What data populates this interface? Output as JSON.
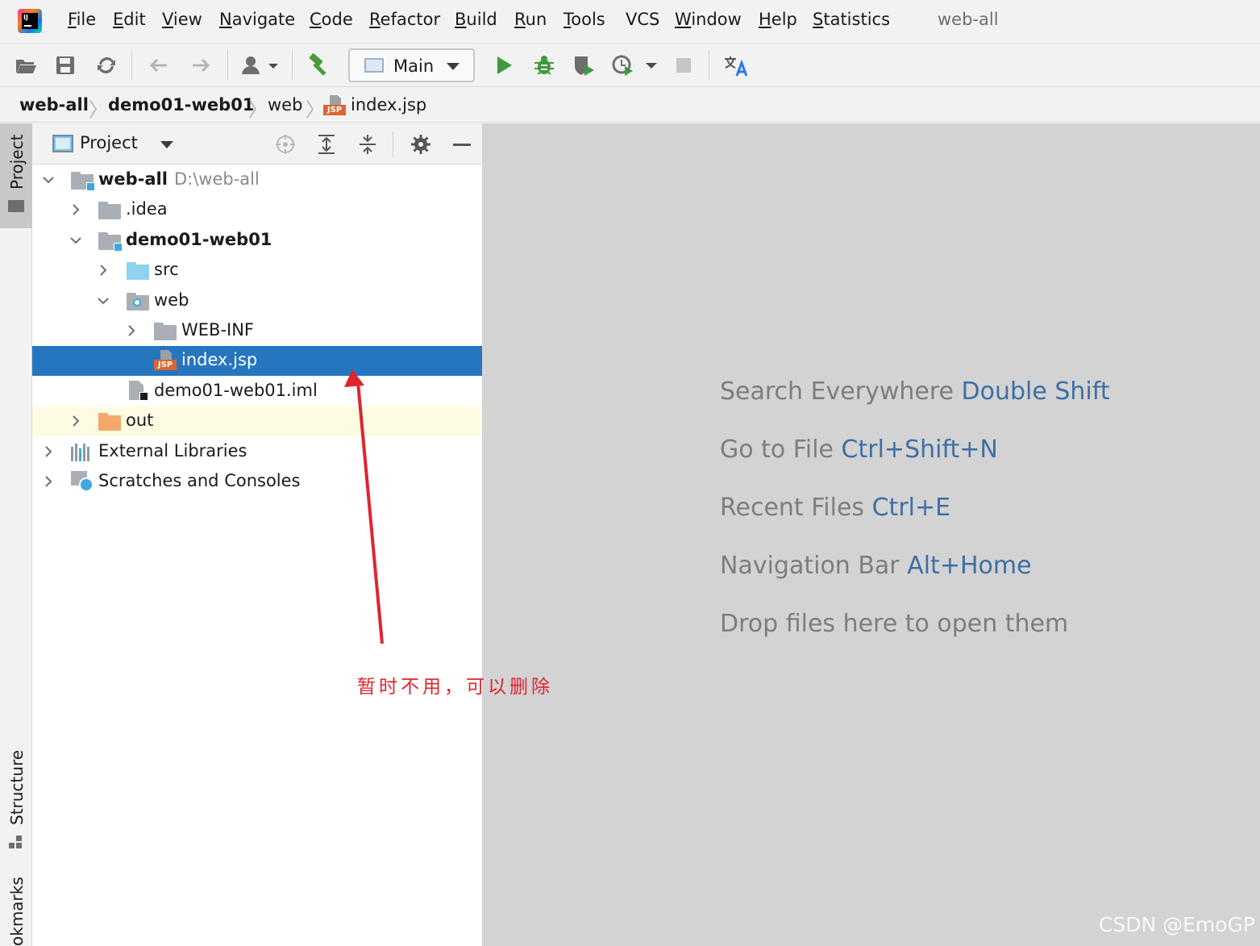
{
  "menubar": {
    "items": [
      {
        "mnemonic": "F",
        "rest": "ile"
      },
      {
        "mnemonic": "E",
        "rest": "dit"
      },
      {
        "mnemonic": "V",
        "rest": "iew"
      },
      {
        "mnemonic": "N",
        "rest": "avigate"
      },
      {
        "mnemonic": "C",
        "rest": "ode"
      },
      {
        "mnemonic": "R",
        "rest": "efactor"
      },
      {
        "mnemonic": "B",
        "rest": "uild"
      },
      {
        "mnemonic": "R",
        "rest": "un"
      },
      {
        "mnemonic": "T",
        "rest": "ools"
      },
      {
        "mnemonic": "",
        "rest": "VCS"
      },
      {
        "mnemonic": "W",
        "rest": "indow"
      },
      {
        "mnemonic": "H",
        "rest": "elp"
      },
      {
        "mnemonic": "S",
        "rest": "tatistics"
      }
    ],
    "window_title": "web-all"
  },
  "toolbar": {
    "run_config": "Main",
    "icons": [
      "open-icon",
      "save-icon",
      "sync-icon",
      "back-icon",
      "forward-icon",
      "vcs-user-icon",
      "build-hammer-icon",
      "run-icon",
      "debug-icon",
      "coverage-icon",
      "profile-icon",
      "stop-icon",
      "translate-icon"
    ]
  },
  "breadcrumb": {
    "items": [
      "web-all",
      "demo01-web01",
      "web",
      "index.jsp"
    ]
  },
  "left_strip": {
    "tabs": [
      "Project",
      "Structure",
      "okmarks"
    ]
  },
  "project_panel": {
    "title": "Project",
    "tree": {
      "root": {
        "label": "web-all",
        "path": "D:\\web-all"
      },
      "idea": ".idea",
      "module": "demo01-web01",
      "src": "src",
      "web": "web",
      "webinf": "WEB-INF",
      "index": "index.jsp",
      "iml": "demo01-web01.iml",
      "out": "out",
      "libs": "External Libraries",
      "scratches": "Scratches and Consoles"
    },
    "jsp_badge": "JSP"
  },
  "editor": {
    "hints": [
      {
        "text": "Search Everywhere",
        "key": "Double Shift"
      },
      {
        "text": "Go to File",
        "key": "Ctrl+Shift+N"
      },
      {
        "text": "Recent Files",
        "key": "Ctrl+E"
      },
      {
        "text": "Navigation Bar",
        "key": "Alt+Home"
      },
      {
        "text": "Drop files here to open them",
        "key": ""
      }
    ],
    "watermark": "CSDN @EmoGP"
  },
  "annotation": {
    "text": "暂时不用，可以删除",
    "color": "#e0242d"
  },
  "colors": {
    "selection": "#2675bf",
    "accent_key": "#3d6fa5",
    "excluded_row": "#fdfbe2"
  }
}
